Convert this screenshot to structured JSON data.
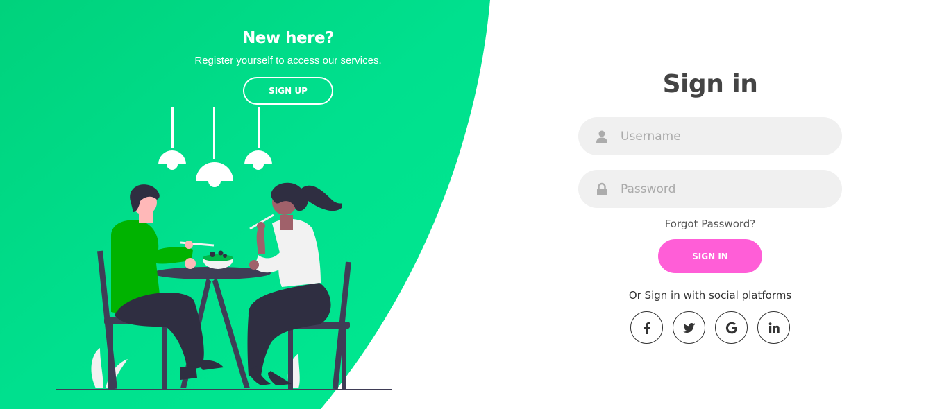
{
  "colors": {
    "panel_green": "#00e08a",
    "accent_pink": "#ff5ed7",
    "input_bg": "#f0f0f0",
    "text_dark": "#444444"
  },
  "left_panel": {
    "title": "New here?",
    "text": "Register yourself to access our services.",
    "signup_label": "SIGN UP"
  },
  "signin_form": {
    "title": "Sign in",
    "username": {
      "placeholder": "Username",
      "value": "",
      "icon": "user-icon"
    },
    "password": {
      "placeholder": "Password",
      "value": "",
      "icon": "lock-icon"
    },
    "forgot_label": "Forgot Password?",
    "signin_label": "SIGN IN",
    "social_text": "Or Sign in with social platforms",
    "social": [
      {
        "name": "facebook-icon"
      },
      {
        "name": "twitter-icon"
      },
      {
        "name": "google-icon"
      },
      {
        "name": "linkedin-icon"
      }
    ]
  }
}
